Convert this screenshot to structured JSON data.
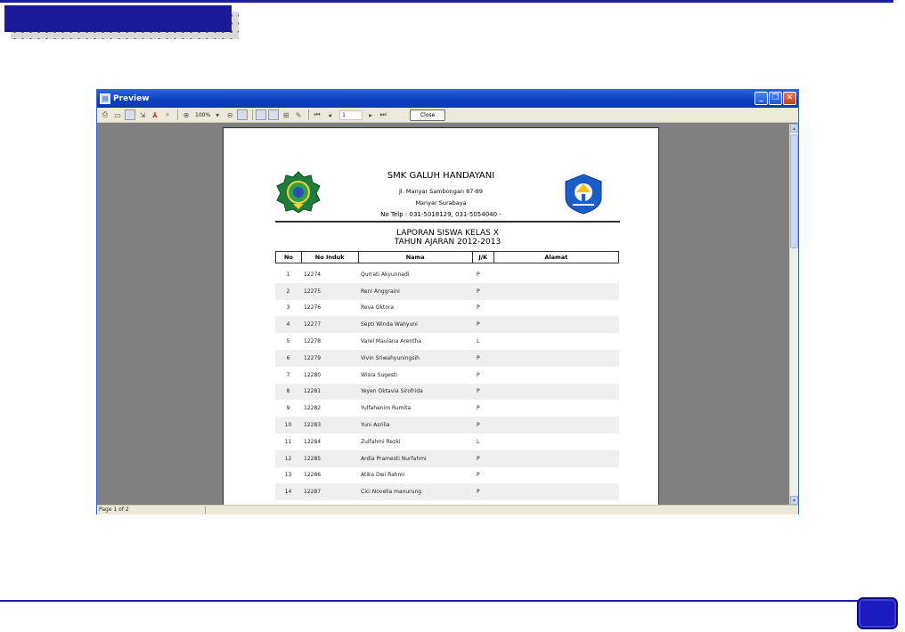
{
  "window": {
    "title": "Preview"
  },
  "toolbar": {
    "zoom": "100%",
    "page_input": "1",
    "close_label": "Close"
  },
  "status": {
    "page": "Page 1 of 2"
  },
  "report": {
    "school_name": "SMK GALUH HANDAYANI",
    "address_line1": "Jl. Manyar Sambongan 87-89",
    "address_line2": "Manyar Surabaya",
    "phone": "No Telp : 031-5018129, 031-5054040  -",
    "title_line1": "LAPORAN SISWA KELAS X",
    "title_line2": "TAHUN AJARAN 2012-2013",
    "columns": [
      "No",
      "No Induk",
      "Nama",
      "J/K",
      "Alamat"
    ],
    "rows": [
      {
        "no": "1",
        "induk": "12274",
        "nama": "Qurrati Akyunnadi",
        "jk": "P",
        "alamat": ""
      },
      {
        "no": "2",
        "induk": "12275",
        "nama": "Reni Anggraini",
        "jk": "P",
        "alamat": ""
      },
      {
        "no": "3",
        "induk": "12276",
        "nama": "Reva Oktora",
        "jk": "P",
        "alamat": ""
      },
      {
        "no": "4",
        "induk": "12277",
        "nama": "Septi Winda Wahyuni",
        "jk": "P",
        "alamat": ""
      },
      {
        "no": "5",
        "induk": "12278",
        "nama": "Varel Maulana Arentha",
        "jk": "L",
        "alamat": ""
      },
      {
        "no": "6",
        "induk": "12279",
        "nama": "Vivin Sriwahyuningsih",
        "jk": "P",
        "alamat": ""
      },
      {
        "no": "7",
        "induk": "12280",
        "nama": "Wisra Sugesti",
        "jk": "P",
        "alamat": ""
      },
      {
        "no": "8",
        "induk": "12281",
        "nama": "Yeyen Oktavia Sirofrida",
        "jk": "P",
        "alamat": ""
      },
      {
        "no": "9",
        "induk": "12282",
        "nama": "Yulfahenim Rumita",
        "jk": "P",
        "alamat": ""
      },
      {
        "no": "10",
        "induk": "12283",
        "nama": "Yuni Asrilia",
        "jk": "P",
        "alamat": ""
      },
      {
        "no": "11",
        "induk": "12284",
        "nama": "Zulfahmi Rezki",
        "jk": "L",
        "alamat": ""
      },
      {
        "no": "12",
        "induk": "12285",
        "nama": "Ardia Pramesti Nurfahmi",
        "jk": "P",
        "alamat": ""
      },
      {
        "no": "13",
        "induk": "12286",
        "nama": "Atika Dwi Rahmi",
        "jk": "P",
        "alamat": ""
      },
      {
        "no": "14",
        "induk": "12287",
        "nama": "Cici Novelia manurung",
        "jk": "P",
        "alamat": ""
      }
    ]
  },
  "colors": {
    "accent": "#1a1a99",
    "titlebar": "#0a3fbe"
  }
}
